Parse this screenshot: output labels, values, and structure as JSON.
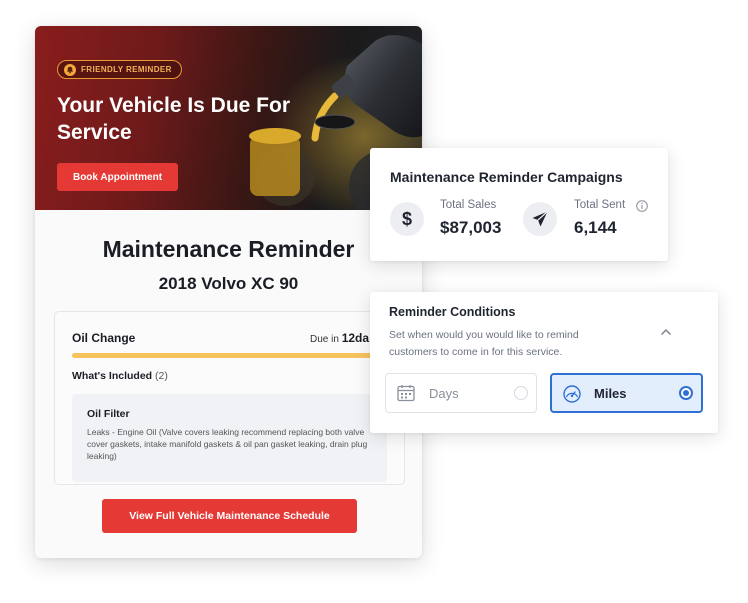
{
  "email": {
    "badge_label": "FRIENDLY REMINDER",
    "hero_title": "Your Vehicle Is Due For Service",
    "book_button": "Book Appointment",
    "title": "Maintenance Reminder",
    "vehicle": "2018 Volvo XC 90",
    "service": {
      "name": "Oil Change",
      "due_prefix": "Due in",
      "due_value": "12da",
      "progress_fraction": 0.95,
      "included_label": "What's Included",
      "included_count": "(2)",
      "part_name": "Oil Filter",
      "part_description": "Leaks - Engine Oil (Valve covers leaking recommend replacing both valve cover gaskets, intake manifold gaskets & oil pan gasket leaking, drain plug leaking)"
    },
    "schedule_button": "View Full Vehicle Maintenance Schedule"
  },
  "campaigns": {
    "title": "Maintenance Reminder Campaigns",
    "sales_label": "Total Sales",
    "sales_value": "$87,003",
    "sent_label": "Total Sent",
    "sent_value": "6,144"
  },
  "conditions": {
    "title": "Reminder Conditions",
    "description": "Set when would you would like to remind customers to come in for this service.",
    "options": [
      {
        "label": "Days",
        "selected": false,
        "icon": "calendar-icon"
      },
      {
        "label": "Miles",
        "selected": true,
        "icon": "speedometer-icon"
      }
    ]
  },
  "colors": {
    "accent_red": "#e53935",
    "badge_orange": "#f3b254",
    "progress_yellow": "#f6c35c",
    "selected_blue": "#2f6fd6"
  }
}
